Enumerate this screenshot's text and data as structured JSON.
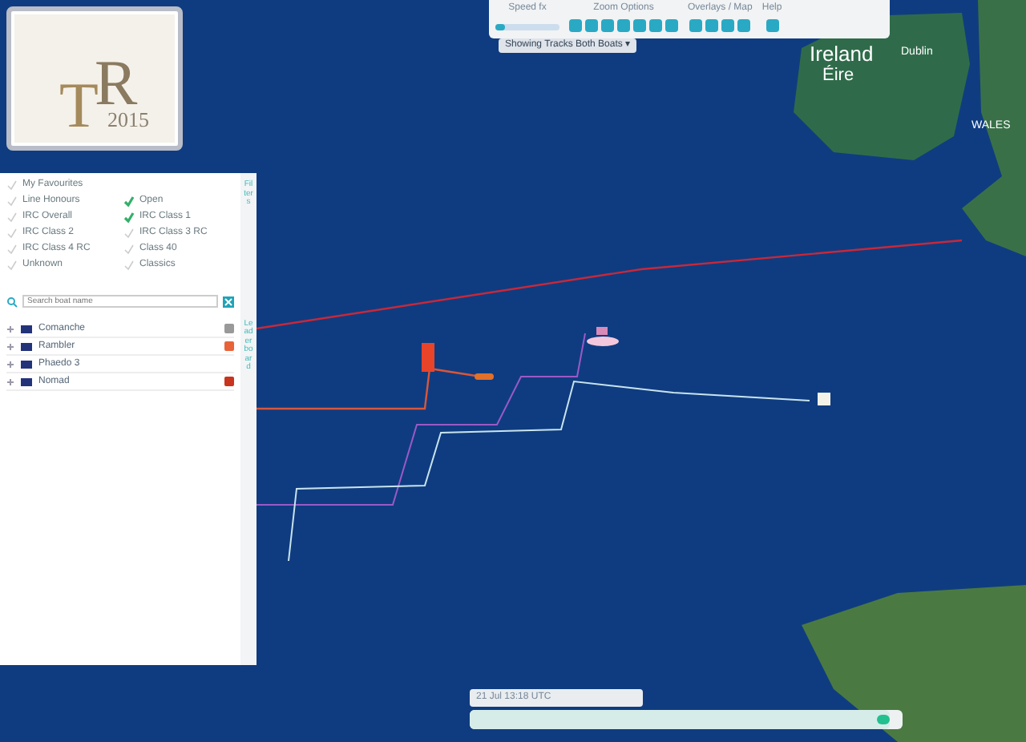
{
  "logo": {
    "letters": [
      "T",
      "R"
    ],
    "year": "2015"
  },
  "toolbar": {
    "groups": [
      {
        "label": "Speed fx",
        "kind": "slider",
        "level": 0.15
      },
      {
        "label": "Zoom Options",
        "kind": "icons"
      },
      {
        "label": "Overlays / Map",
        "kind": "icons"
      },
      {
        "label": "Help",
        "kind": "icons"
      }
    ],
    "dropdown": "Showing Tracks Both Boats ▾"
  },
  "map_labels": [
    "Ireland",
    "Éire",
    "WALES",
    "Dublin"
  ],
  "panel": {
    "side_tabs": [
      "Filters",
      "Leaderboard"
    ],
    "filters": [
      {
        "label": "My Favourites",
        "checked": false
      },
      {
        "label": "Line Honours",
        "checked": false
      },
      {
        "label": "Open",
        "checked": true
      },
      {
        "label": "IRC Overall",
        "checked": false
      },
      {
        "label": "IRC Class 1",
        "checked": true
      },
      {
        "label": "IRC Class 2",
        "checked": false
      },
      {
        "label": "IRC Class 3 RC",
        "checked": false
      },
      {
        "label": "IRC Class 4 RC",
        "checked": false
      },
      {
        "label": "Class 40",
        "checked": false
      },
      {
        "label": "Unknown",
        "checked": false
      },
      {
        "label": "Classics",
        "checked": false
      }
    ],
    "search": {
      "placeholder": "Search boat name"
    },
    "boats": [
      {
        "name": "Comanche",
        "color": "#999999"
      },
      {
        "name": "Rambler",
        "color": "#e8623a"
      },
      {
        "name": "Phaedo 3"
      },
      {
        "name": "Nomad",
        "color": "#c8341e"
      }
    ]
  },
  "timeline": {
    "time": "21 Jul 13:18 UTC",
    "level": 0.97
  }
}
